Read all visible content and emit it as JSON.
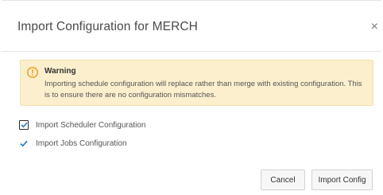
{
  "dialog": {
    "title": "Import Configuration for MERCH",
    "close_glyph": "×"
  },
  "warning": {
    "icon": "warning-icon",
    "title": "Warning",
    "message": "Importing schedule configuration will replace rather than merge with existing configuration. This is to ensure there are no configuration mismatches."
  },
  "options": [
    {
      "label": "Import Scheduler Configuration",
      "checked": true
    },
    {
      "label": "Import Jobs Configuration",
      "checked": true
    }
  ],
  "buttons": {
    "cancel_label": "Cancel",
    "import_label": "Import Config"
  },
  "colors": {
    "warning_bg": "#fbefcd",
    "warning_icon": "#f0a12c",
    "checkbox_focus": "#2b2b2b",
    "checkbox_check": "#2a7fc4"
  }
}
